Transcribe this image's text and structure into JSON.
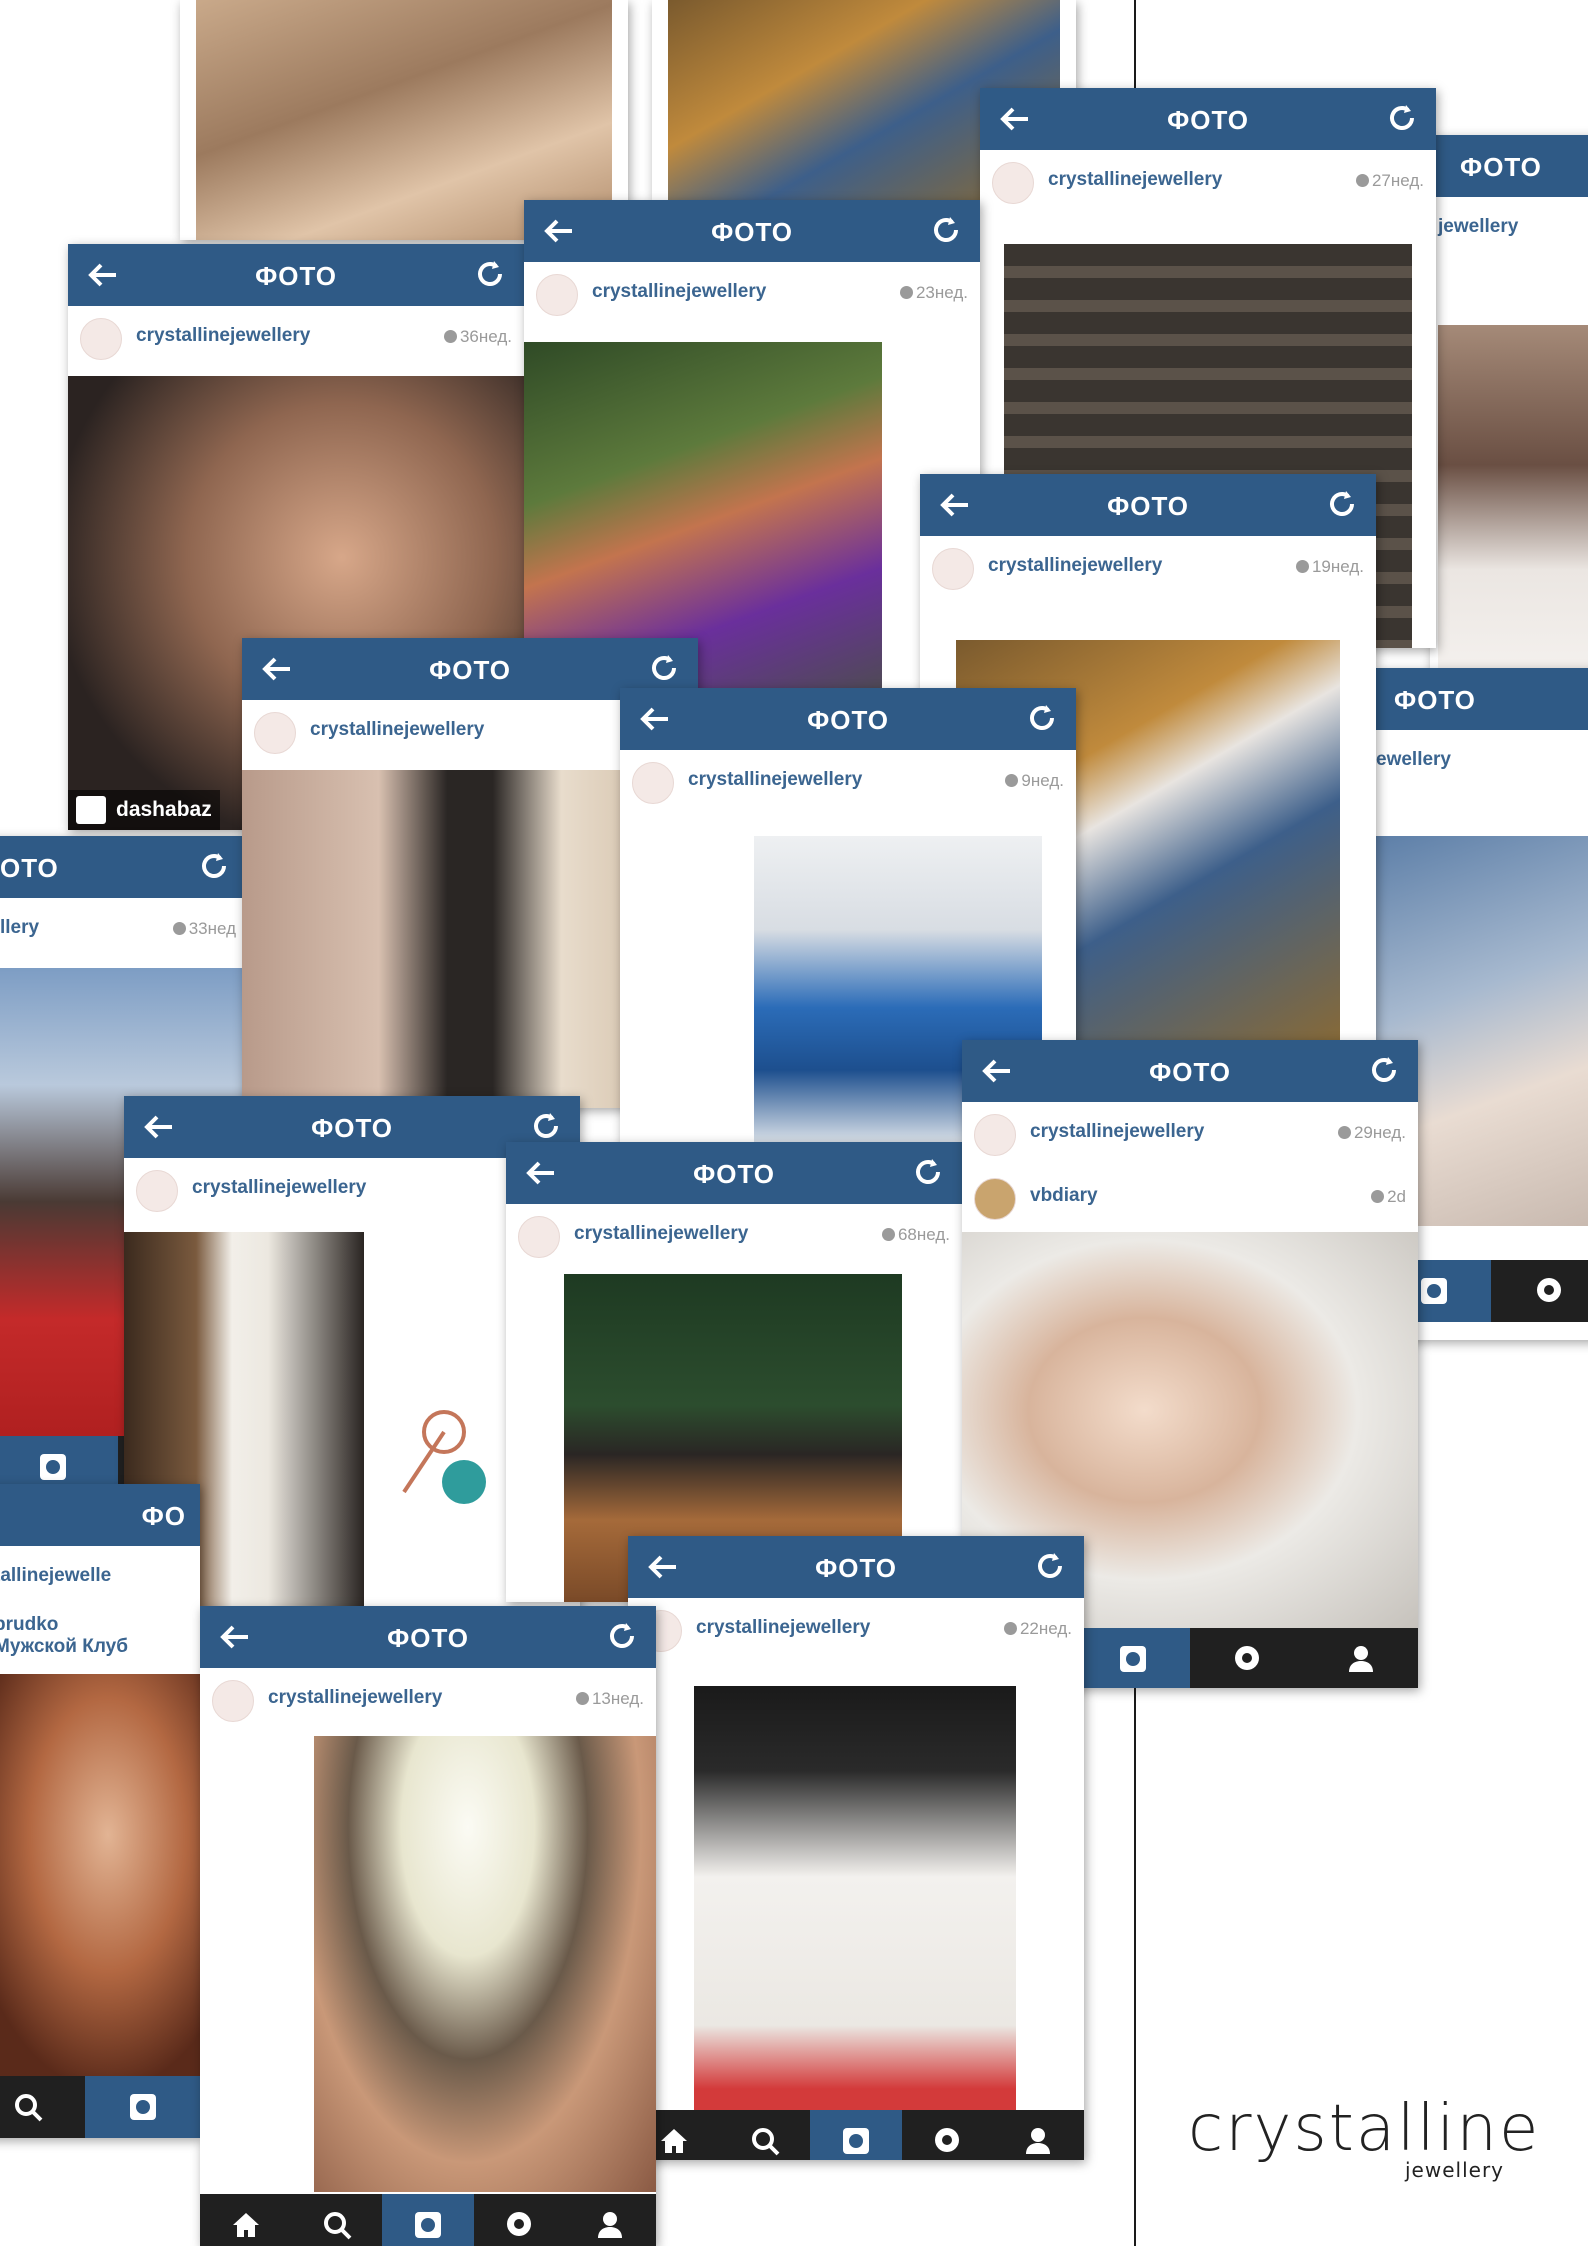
{
  "header_title": "ФОТО",
  "username": "crystallinejewellery",
  "cards": {
    "c1": {
      "age": "36нед.",
      "tag": "dashabaz"
    },
    "c2": {
      "age": "23нед."
    },
    "c3": {
      "age": "27нед."
    },
    "c4": {
      "username": "jewellery"
    },
    "c5": {
      "age": "19нед."
    },
    "c6": {
      "age": ""
    },
    "c7": {
      "age": "9нед."
    },
    "c8": {
      "username": "ewellery"
    },
    "c9": {
      "title": "ОТО",
      "username": "llery",
      "age": "33нед"
    },
    "c10": {
      "age": ""
    },
    "c11": {
      "age": "68нед."
    },
    "c12": {
      "age": "29нед.",
      "second_user": "vbdiary",
      "second_age": "2d"
    },
    "c13": {
      "title": "ФО",
      "username": "tallinejewelle",
      "comment_user": "prudko",
      "comment_text": "Мужской Клуб"
    },
    "c14": {
      "age": "22нед."
    },
    "c15": {
      "age": "13нед."
    }
  },
  "branding": {
    "logo": "crystalline",
    "sub": "jewellery"
  },
  "colors": {
    "header": "#2f5a86",
    "tabbar": "#202020",
    "username": "#3b6590"
  },
  "icons": [
    "back-arrow-icon",
    "refresh-icon",
    "clock-icon",
    "home-icon",
    "search-icon",
    "camera-icon",
    "activity-icon",
    "profile-icon"
  ]
}
